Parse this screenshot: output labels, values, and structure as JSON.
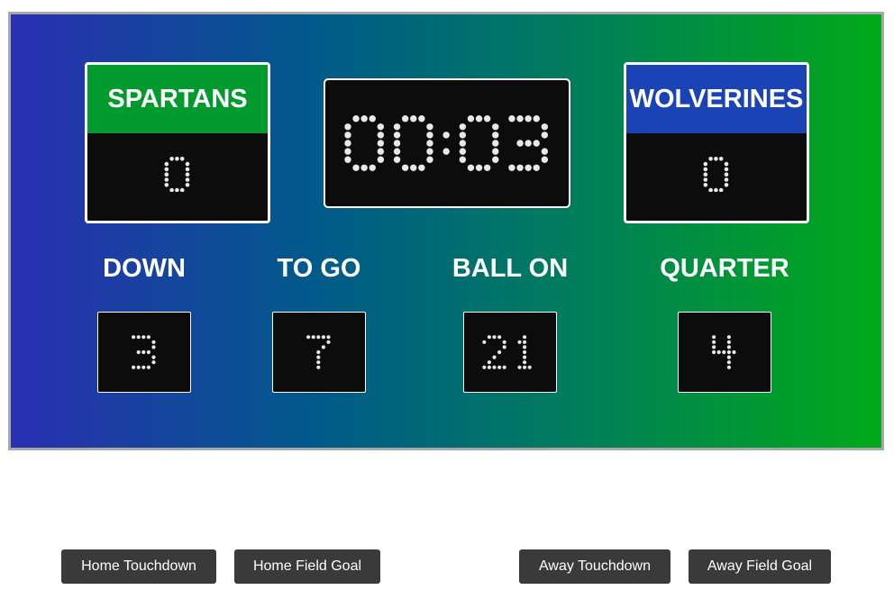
{
  "scoreboard": {
    "home": {
      "name": "SPARTANS",
      "score": "0",
      "color": "#009a2e"
    },
    "away": {
      "name": "WOLVERINES",
      "score": "0",
      "color": "#1a44b5"
    },
    "clock": "00:03",
    "stats": [
      {
        "label": "DOWN",
        "value": "3"
      },
      {
        "label": "TO GO",
        "value": "7"
      },
      {
        "label": "BALL ON",
        "value": "21"
      },
      {
        "label": "QUARTER",
        "value": "4"
      }
    ]
  },
  "controls": {
    "home_touchdown": "Home Touchdown",
    "home_field_goal": "Home Field Goal",
    "away_touchdown": "Away Touchdown",
    "away_field_goal": "Away Field Goal"
  }
}
